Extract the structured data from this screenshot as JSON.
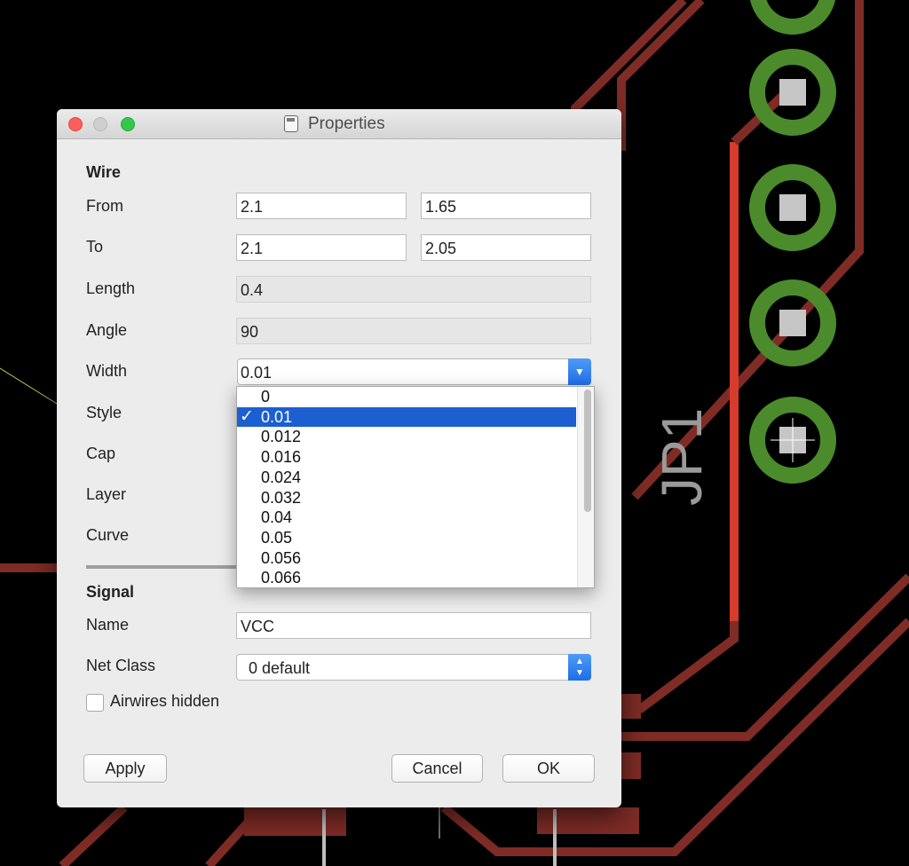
{
  "window": {
    "title": "Properties"
  },
  "canvas": {
    "part_label": "JP1"
  },
  "wire": {
    "heading": "Wire",
    "from": {
      "label": "From",
      "x": "2.1",
      "y": "1.65"
    },
    "to": {
      "label": "To",
      "x": "2.1",
      "y": "2.05"
    },
    "length": {
      "label": "Length",
      "value": "0.4"
    },
    "angle": {
      "label": "Angle",
      "value": "90"
    },
    "width": {
      "label": "Width",
      "value": "0.01"
    },
    "style": {
      "label": "Style"
    },
    "cap": {
      "label": "Cap"
    },
    "layer": {
      "label": "Layer"
    },
    "curve": {
      "label": "Curve"
    }
  },
  "width_options": {
    "items": [
      "0",
      "0.01",
      "0.012",
      "0.016",
      "0.024",
      "0.032",
      "0.04",
      "0.05",
      "0.056",
      "0.066"
    ],
    "selected_index": 1,
    "check_mark": "✓"
  },
  "signal": {
    "heading": "Signal",
    "name": {
      "label": "Name",
      "value": "VCC"
    },
    "net_class": {
      "label": "Net Class",
      "value": "0 default"
    },
    "airwires": {
      "label": "Airwires hidden",
      "checked": false
    }
  },
  "buttons": {
    "apply": "Apply",
    "cancel": "Cancel",
    "ok": "OK"
  },
  "colors": {
    "trace_dark_red": "#7f2c26",
    "trace_bright_red": "#d63b2b",
    "pad_green": "#4b8b2b",
    "pad_gray": "#c6c6c6",
    "selection_blue": "#1c5fd0"
  }
}
